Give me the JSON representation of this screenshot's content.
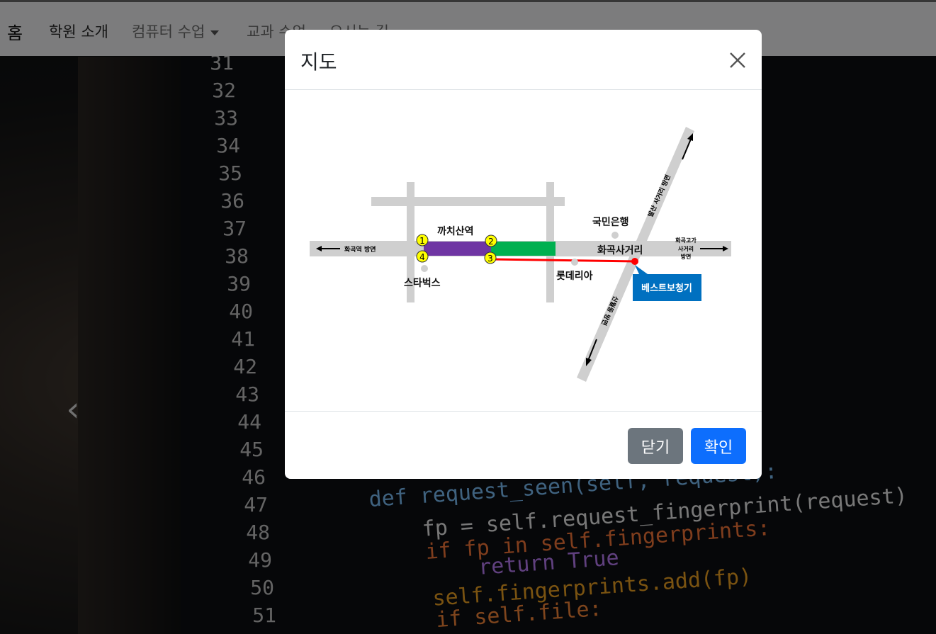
{
  "navbar": {
    "brand": "홈",
    "items": [
      {
        "label": "학원 소개"
      },
      {
        "label": "컴퓨터 수업"
      },
      {
        "label": "교과 수업"
      },
      {
        "label": "오시는 길"
      }
    ]
  },
  "background": {
    "line_numbers": [
      "31",
      "32",
      "33",
      "34",
      "35",
      "36",
      "37",
      "38",
      "39",
      "40",
      "41",
      "42",
      "43",
      "44",
      "45",
      "46",
      "47",
      "48",
      "49",
      "50",
      "51"
    ],
    "code_lines": [
      {
        "text": "def request_seen(self, request):",
        "color": "#7fc4ff"
      },
      {
        "text": "fp = self.request_fingerprint(request)",
        "color": "#f0f0f0"
      },
      {
        "text": "if fp in self.fingerprints:",
        "color": "#ff7a3a"
      },
      {
        "text": "return True",
        "color": "#c080ff"
      },
      {
        "text": "self.fingerprints.add(fp)",
        "color": "#f5a623"
      },
      {
        "text": "if self.file:",
        "color": "#ff8a3a"
      }
    ],
    "carousel_prev_icon": "chevron-left-icon"
  },
  "modal": {
    "title": "지도",
    "close_icon": "close-icon",
    "footer": {
      "close_label": "닫기",
      "confirm_label": "확인"
    },
    "map": {
      "station": "까치산역",
      "exits": [
        "1",
        "2",
        "3",
        "4"
      ],
      "landmarks": {
        "starbucks": "스타벅스",
        "kb_bank": "국민은행",
        "lotteria": "롯데리아",
        "crossroad": "화곡사거리",
        "destination": "베스트보청기"
      },
      "directions": {
        "west": "화곡역 방면",
        "east_line1": "화곡고가",
        "east_line2": "사거리",
        "east_line3": "방면",
        "north": "발산 사거리 방면",
        "south": "신월동 방면"
      },
      "colors": {
        "road": "#cfcfcf",
        "purple_segment": "#6f35a3",
        "green_segment": "#00b050",
        "route": "#ff0000",
        "exit_marker": "#ffff00",
        "destination_box": "#0070c0"
      }
    }
  }
}
